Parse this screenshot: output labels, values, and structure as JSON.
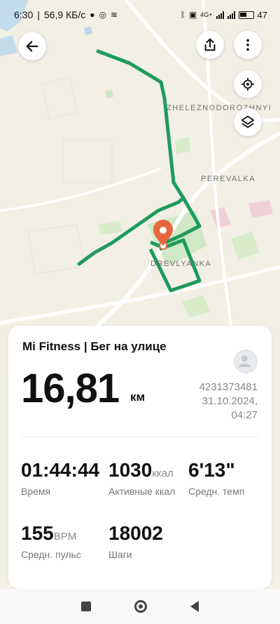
{
  "status_bar": {
    "time": "6:30",
    "speed": "56,9 КБ/с",
    "network": "4G+",
    "battery": "47"
  },
  "map": {
    "labels": {
      "zheleznodorozhnyi": "ZHELEZNODOROZHNYI",
      "perevalka": "PEREVALKA",
      "drevlyanka": "DREVLYANKA"
    },
    "route_color": "#1e9b5a",
    "pin_color": "#e8663d"
  },
  "buttons": {
    "back_icon": "arrow-left-icon",
    "share_icon": "share-icon",
    "more_icon": "more-vertical-icon",
    "locate_icon": "location-target-icon",
    "layers_icon": "layers-icon"
  },
  "workout": {
    "title": "Mi Fitness | Бег на улице",
    "distance": "16,81",
    "distance_unit": "км",
    "user_id": "4231373481",
    "date": "31.10.2024,",
    "time": "04:27",
    "stats": [
      {
        "value": "01:44:44",
        "unit": "",
        "label": "Время"
      },
      {
        "value": "1030",
        "unit": "ккал",
        "label": "Активные ккал"
      },
      {
        "value": "6'13\"",
        "unit": "",
        "label": "Средн. темп"
      },
      {
        "value": "155",
        "unit": "BPM",
        "label": "Средн. пульс"
      },
      {
        "value": "18002",
        "unit": "",
        "label": "Шаги"
      }
    ]
  }
}
